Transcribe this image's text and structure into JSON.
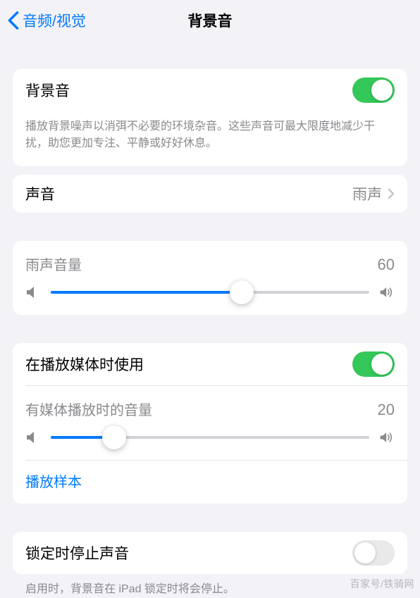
{
  "nav": {
    "back_label": "音频/视觉",
    "title": "背景音"
  },
  "section1": {
    "toggle_label": "背景音",
    "toggle_on": true,
    "description": "播放背景噪声以消弭不必要的环境杂音。这些声音可最大限度地减少干扰，助您更加专注、平静或好好休息。"
  },
  "sound_row": {
    "label": "声音",
    "value": "雨声"
  },
  "volume1": {
    "label": "雨声音量",
    "value": 60
  },
  "section_media": {
    "toggle_label": "在播放媒体时使用",
    "toggle_on": true,
    "volume_label": "有媒体播放时的音量",
    "volume_value": 20,
    "sample_link": "播放样本"
  },
  "section_lock": {
    "toggle_label": "锁定时停止声音",
    "toggle_on": false,
    "description": "启用时，背景音在 iPad 锁定时将会停止。"
  },
  "watermark": "百家号/铁骑网"
}
